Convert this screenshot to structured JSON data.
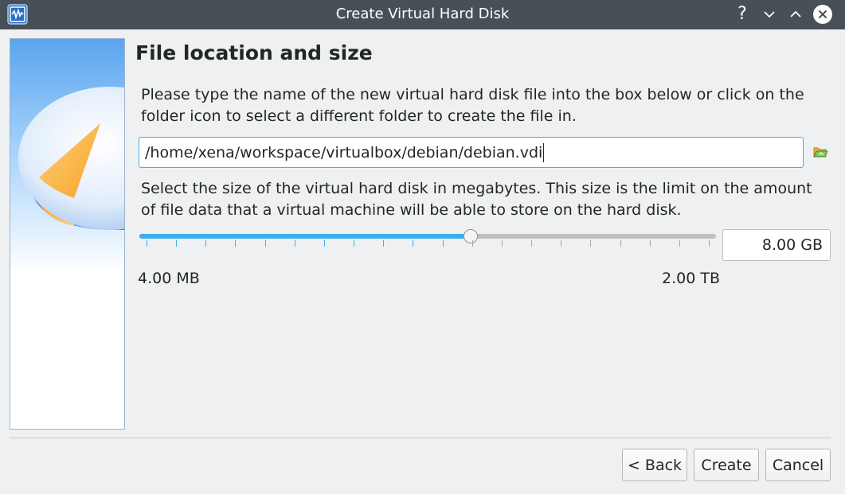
{
  "window": {
    "title": "Create Virtual Hard Disk",
    "help_glyph": "?"
  },
  "page": {
    "title": "File location and size",
    "location_description": "Please type the name of the new virtual hard disk file into the box below or click on the folder icon to select a different folder to create the file in.",
    "location_value": "/home/xena/workspace/virtualbox/debian/debian.vdi",
    "size_description": "Select the size of the virtual hard disk in megabytes. This size is the limit on the amount of file data that a virtual machine will be able to store on the hard disk.",
    "size_value": "8.00 GB",
    "slider_fraction": 0.576,
    "slider_tick_count": 20,
    "range_min": "4.00 MB",
    "range_max": "2.00 TB"
  },
  "buttons": {
    "back": "< Back",
    "create": "Create",
    "cancel": "Cancel"
  },
  "colors": {
    "accent": "#3daee9",
    "titlebar": "#475057",
    "window_bg": "#eff0f1"
  },
  "icons": {
    "app": "virtualbox-icon",
    "folder": "folder-open-icon",
    "help": "help-icon",
    "minimize": "chevron-down-icon",
    "maximize": "chevron-up-icon",
    "close": "close-icon"
  }
}
